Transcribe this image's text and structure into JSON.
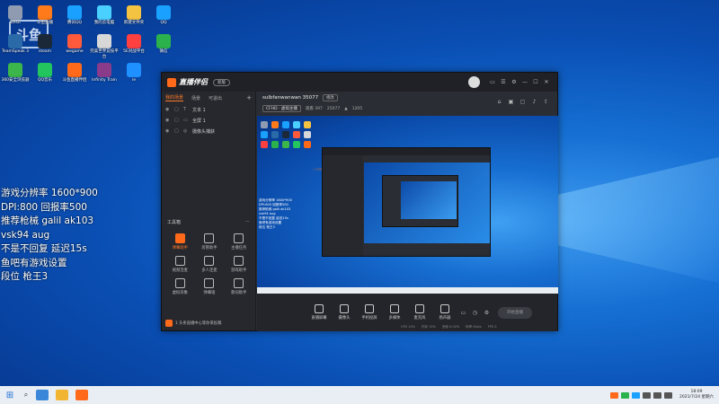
{
  "desktop": {
    "overlay_logo": "斗鱼",
    "icons": [
      {
        "label": "DXGI",
        "color": "#8e9bb0"
      },
      {
        "label": "斗鱼直播",
        "color": "#ff7a1a"
      },
      {
        "label": "腾讯QQ",
        "color": "#1aa1ff"
      },
      {
        "label": "我的云电脑",
        "color": "#4ad0ff"
      },
      {
        "label": "新建文件夹",
        "color": "#f5c342"
      },
      {
        "label": "QQ",
        "color": "#1aa1ff"
      },
      {
        "label": "TeamSpeak 3",
        "color": "#2b6aa8"
      },
      {
        "label": "steam",
        "color": "#1b2838"
      },
      {
        "label": "wegame",
        "color": "#ff5a3c"
      },
      {
        "label": "完美世界竞技平台",
        "color": "#d8d8d8"
      },
      {
        "label": "5E对战平台",
        "color": "#ff4040"
      },
      {
        "label": "微信",
        "color": "#2bb24c"
      },
      {
        "label": "360安全浏览器",
        "color": "#3cb54a"
      },
      {
        "label": "QQ音乐",
        "color": "#22c55e"
      },
      {
        "label": "斗鱼直播伴侣",
        "color": "#ff6a1a"
      },
      {
        "label": "Infinity Train",
        "color": "#8a3c8a"
      },
      {
        "label": "ie",
        "color": "#1e90ff"
      }
    ],
    "info_lines": [
      "游戏分辨率 1600*900",
      "DPI:800 回报率500",
      "推荐枪械 galil ak103",
      "vsk94 aug",
      "不是不回复 延迟15s",
      "鱼吧有游戏设置",
      "段位 枪王3"
    ]
  },
  "app": {
    "title": "直播伴侣",
    "version_pill": "新版",
    "window_controls": [
      "皮肤",
      "菜单",
      "设置",
      "最小化",
      "最大化",
      "关闭"
    ],
    "tabs": [
      "我的场景",
      "场景",
      "可退出"
    ],
    "scenes": [
      "文本 1",
      "全屏 1",
      "摄像头捕获"
    ],
    "tools_title": "工具箱",
    "tools": [
      {
        "label": "弹幕助手",
        "hot": true
      },
      {
        "label": "房管助手",
        "hot": false
      },
      {
        "label": "主播任务",
        "hot": false
      },
      {
        "label": "视频连麦",
        "hot": false
      },
      {
        "label": "多人连麦",
        "hot": false
      },
      {
        "label": "游戏助手",
        "hot": false
      },
      {
        "label": "虚拟形象",
        "hot": false
      },
      {
        "label": "弹幕墙",
        "hot": false
      },
      {
        "label": "歌词助手",
        "hot": false
      }
    ],
    "footer_note": "1 头条直播中心等你来投稿",
    "room": {
      "name": "sulbfanwanwan 35077",
      "edit_label": "修改",
      "category": "CFHD · 虚拟主播",
      "viewers": "观看 397",
      "hot": "25077",
      "gifts": "1205"
    },
    "controls": [
      "直播屏幕",
      "摄像头",
      "手机投屏",
      "多媒体",
      "麦克风",
      "扬声器"
    ],
    "go_live": "开始直播",
    "status": [
      "CPU 10%",
      "内存 15%",
      "丢帧 0.00%",
      "码率 0kb/s",
      "FPS 0"
    ]
  },
  "preview": {
    "text_lines": [
      "游戏分辨率 1600*900",
      "DPI:800 回报率500",
      "推荐枪械 galil ak103",
      "vsk94 aug",
      "不是不回复 延迟15s",
      "鱼吧有游戏设置",
      "段位 枪王3"
    ]
  },
  "taskbar": {
    "time": "18:09",
    "date": "2021/7/24 星期六"
  }
}
